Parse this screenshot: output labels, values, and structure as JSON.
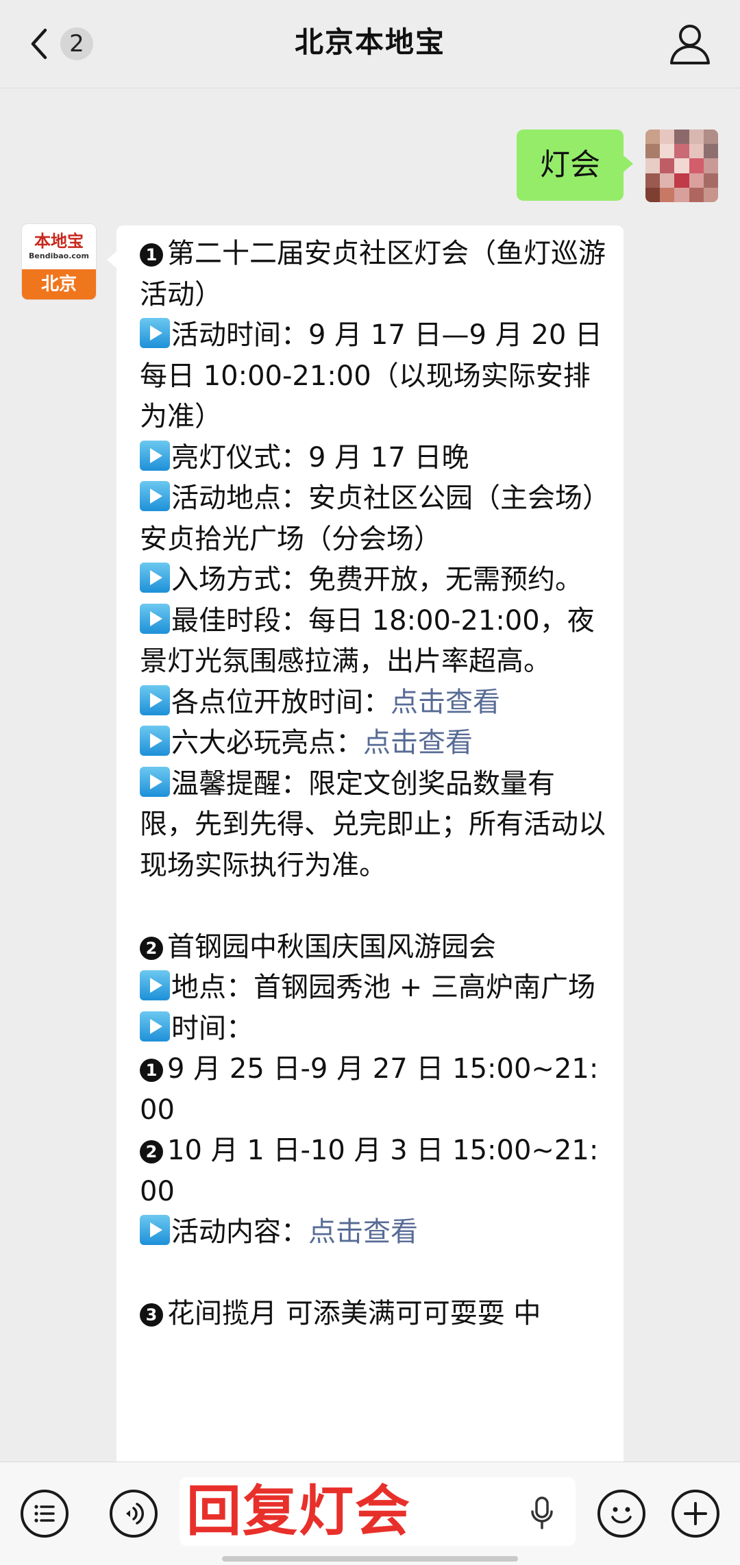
{
  "header": {
    "title": "北京本地宝",
    "unread_count": "2"
  },
  "messages": {
    "user_text": "灯会",
    "bot_avatar": {
      "logo_text": "本地宝",
      "logo_sub": "Bendibao.com",
      "city": "北京"
    },
    "reply": {
      "item1_num": "1",
      "item1_title": "第二十二届安贞社区灯会（鱼灯巡游活动）",
      "item1_time": "活动时间：9 月 17 日—9 月 20 日每日 10:00-21:00（以现场实际安排为准）",
      "item1_light": "亮灯仪式：9 月 17 日晚",
      "item1_place": "活动地点：安贞社区公园（主会场）安贞拾光广场（分会场）",
      "item1_entry": "入场方式：免费开放，无需预约。",
      "item1_best": "最佳时段：每日 18:00-21:00，夜景灯光氛围感拉满，出片率超高。",
      "item1_open_label": "各点位开放时间：",
      "item1_open_link": "点击查看",
      "item1_highlights_label": "六大必玩亮点：",
      "item1_highlights_link": "点击查看",
      "item1_tip": "温馨提醒：限定文创奖品数量有限，先到先得、兑完即止；所有活动以现场实际执行为准。",
      "item2_num": "2",
      "item2_title": "首钢园中秋国庆国风游园会",
      "item2_place": "地点：首钢园秀池 + 三高炉南广场",
      "item2_time_label": "时间：",
      "item2_time1_num": "1",
      "item2_time1": "9 月 25 日-9 月 27 日 15:00~21:00",
      "item2_time2_num": "2",
      "item2_time2": "10 月 1 日-10 月 3 日 15:00~21:00",
      "item2_content_label": "活动内容：",
      "item2_content_link": "点击查看",
      "item3_num": "3",
      "item3_title": "花间揽月 可添美满可可耍耍 中"
    }
  },
  "input": {
    "value": "回复灯会"
  },
  "icons": {
    "back": "chevron-left-icon",
    "profile": "person-icon",
    "menu": "list-icon",
    "voice": "voice-icon",
    "mic": "microphone-icon",
    "emoji": "smiley-icon",
    "plus": "plus-icon"
  },
  "colors": {
    "background": "#ededed",
    "my_bubble": "#95ec69",
    "link": "#576b95",
    "input_text": "#e8302b",
    "logo_orange": "#f0761e"
  }
}
